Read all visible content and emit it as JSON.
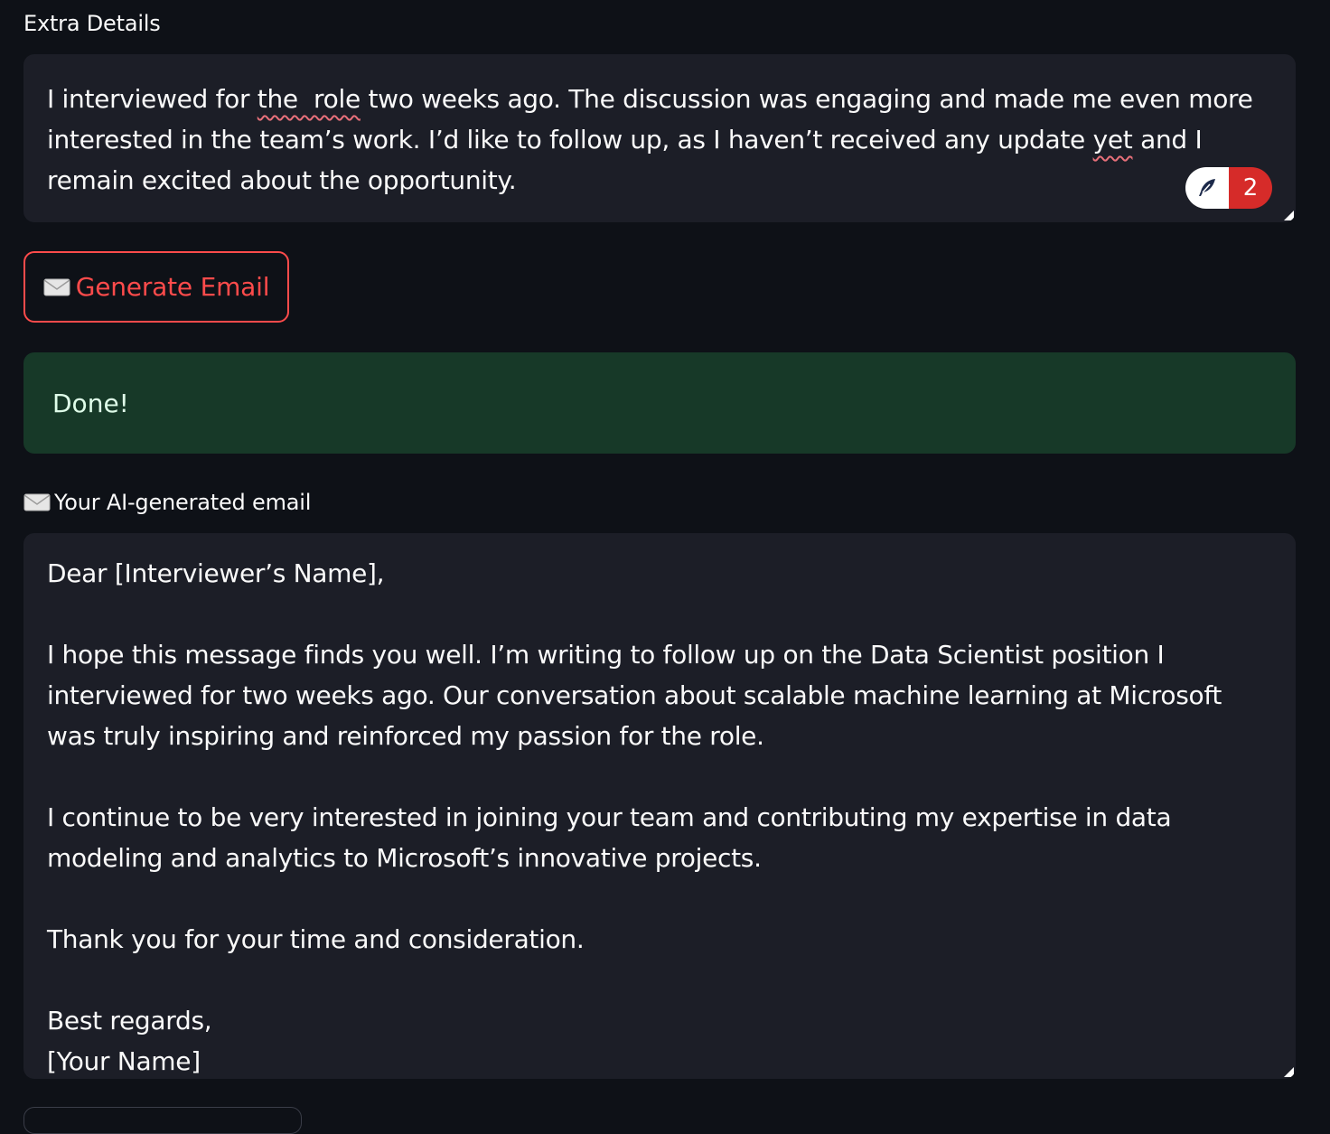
{
  "extra_details": {
    "label": "Extra Details",
    "value_parts": [
      "I interviewed for ",
      "the  role",
      " two weeks ago. The discussion was engaging and made me even more interested in the team’s work. I’d like to follow up, as I haven’t received any update ",
      "yet",
      " and I remain excited about the opportunity."
    ],
    "grammar_issue_count": "2"
  },
  "generate_button": {
    "label": "Generate Email",
    "icon": "envelope-icon"
  },
  "status": {
    "message": "Done!",
    "color": "#173928"
  },
  "email_output": {
    "label": "Your AI-generated email",
    "icon": "envelope-icon",
    "value": "Dear [Interviewer’s Name],\n\nI hope this message finds you well. I’m writing to follow up on the Data Scientist position I interviewed for two weeks ago. Our conversation about scalable machine learning at Microsoft was truly inspiring and reinforced my passion for the role.\n\nI continue to be very interested in joining your team and contributing my expertise in data modeling and analytics to Microsoft’s innovative projects.\n\nThank you for your time and consideration.\n\nBest regards,\n[Your Name]"
  },
  "colors": {
    "background": "#0e1117",
    "input_bg": "#1c1e27",
    "accent": "#ff4b4b",
    "success_bg": "#173928",
    "grammar_badge": "#d62b29"
  }
}
